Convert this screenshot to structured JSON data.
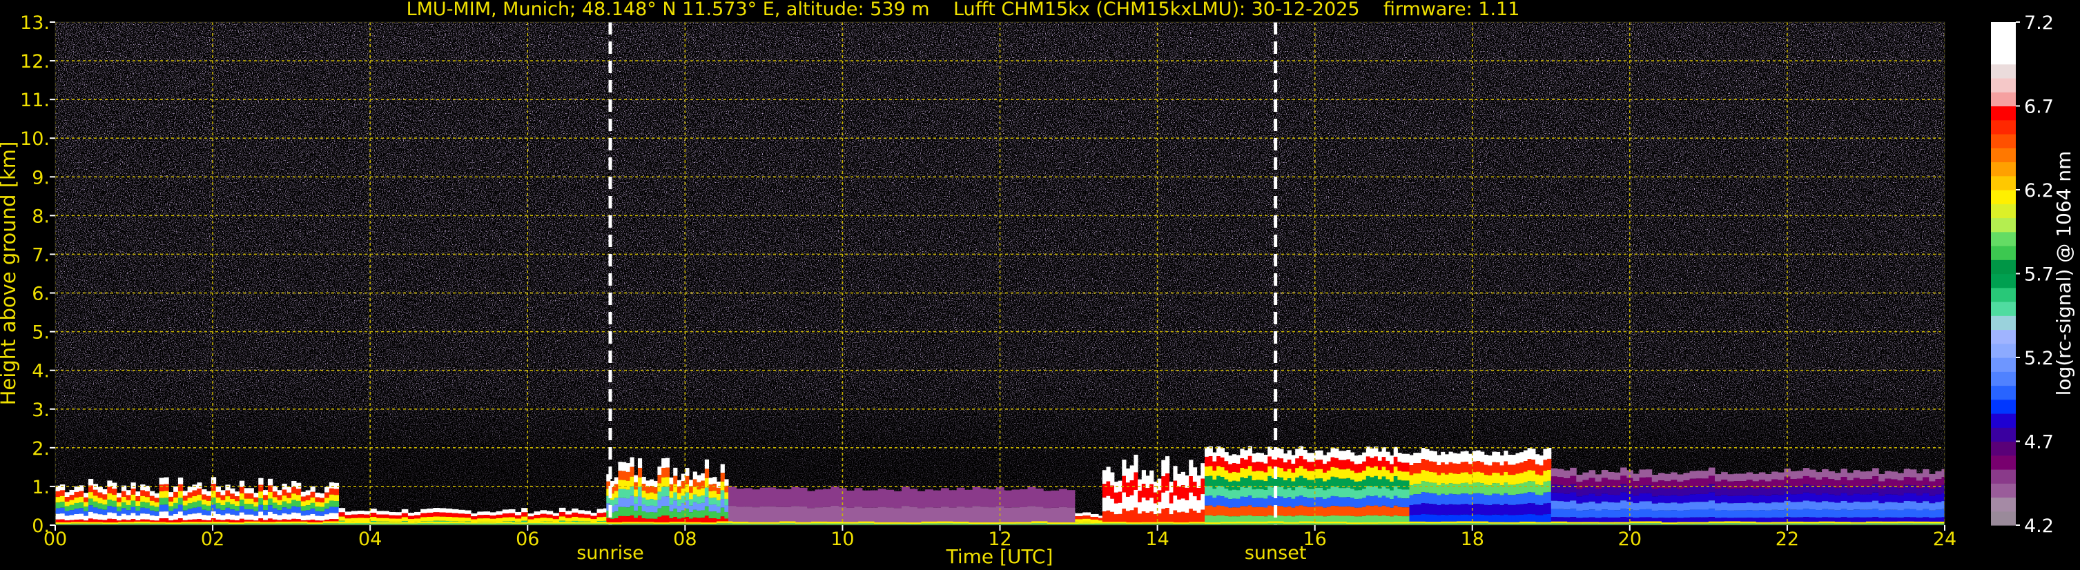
{
  "chart_data": {
    "type": "heatmap",
    "title": "LMU-MIM, Munich; 48.148° N 11.573° E, altitude: 539 m    Lufft CHM15kx (CHM15kxLMU): 30-12-2025    firmware: 1.11",
    "xlabel": "Time [UTC]",
    "ylabel": "Height above ground [km]",
    "xlim": [
      0,
      24
    ],
    "ylim": [
      0,
      13
    ],
    "x_ticks": [
      "00",
      "02",
      "04",
      "06",
      "08",
      "10",
      "12",
      "14",
      "16",
      "18",
      "20",
      "22",
      "24"
    ],
    "y_ticks": [
      "0.",
      "1.",
      "2.",
      "3.",
      "4.",
      "5.",
      "6.",
      "7.",
      "8.",
      "9.",
      "10.",
      "11.",
      "12.",
      "13."
    ],
    "grid": true,
    "events": [
      {
        "label": "sunrise",
        "time": 7.05
      },
      {
        "label": "sunset",
        "time": 15.5
      }
    ],
    "colorbar": {
      "label": "log(rc-signal) @ 1064 nm",
      "range": [
        4.2,
        7.2
      ],
      "ticks": [
        "4.2",
        "4.7",
        "5.2",
        "5.7",
        "6.2",
        "6.7",
        "7.2"
      ],
      "colors": [
        "#9a8a9a",
        "#a58aa5",
        "#9a5c9a",
        "#8a3a8a",
        "#78006e",
        "#5a0078",
        "#3a00a0",
        "#1e00d2",
        "#0037ff",
        "#2864ff",
        "#5082ff",
        "#6e96ff",
        "#8caaff",
        "#a0b4ff",
        "#9ad2dc",
        "#50dca0",
        "#28c878",
        "#00a050",
        "#009646",
        "#3cc850",
        "#64dc64",
        "#b4ee50",
        "#dcf028",
        "#fff000",
        "#ffc800",
        "#ffa000",
        "#ff7800",
        "#ff5000",
        "#ff2800",
        "#ff0000",
        "#f5a0a0",
        "#f5c8c8",
        "#ebdcdc",
        "#ffffff",
        "#ffffff",
        "#ffffff"
      ]
    },
    "colors": {
      "axis_text": "#f0e000",
      "grid": "#c8b400",
      "event_line": "#ffffff"
    }
  }
}
